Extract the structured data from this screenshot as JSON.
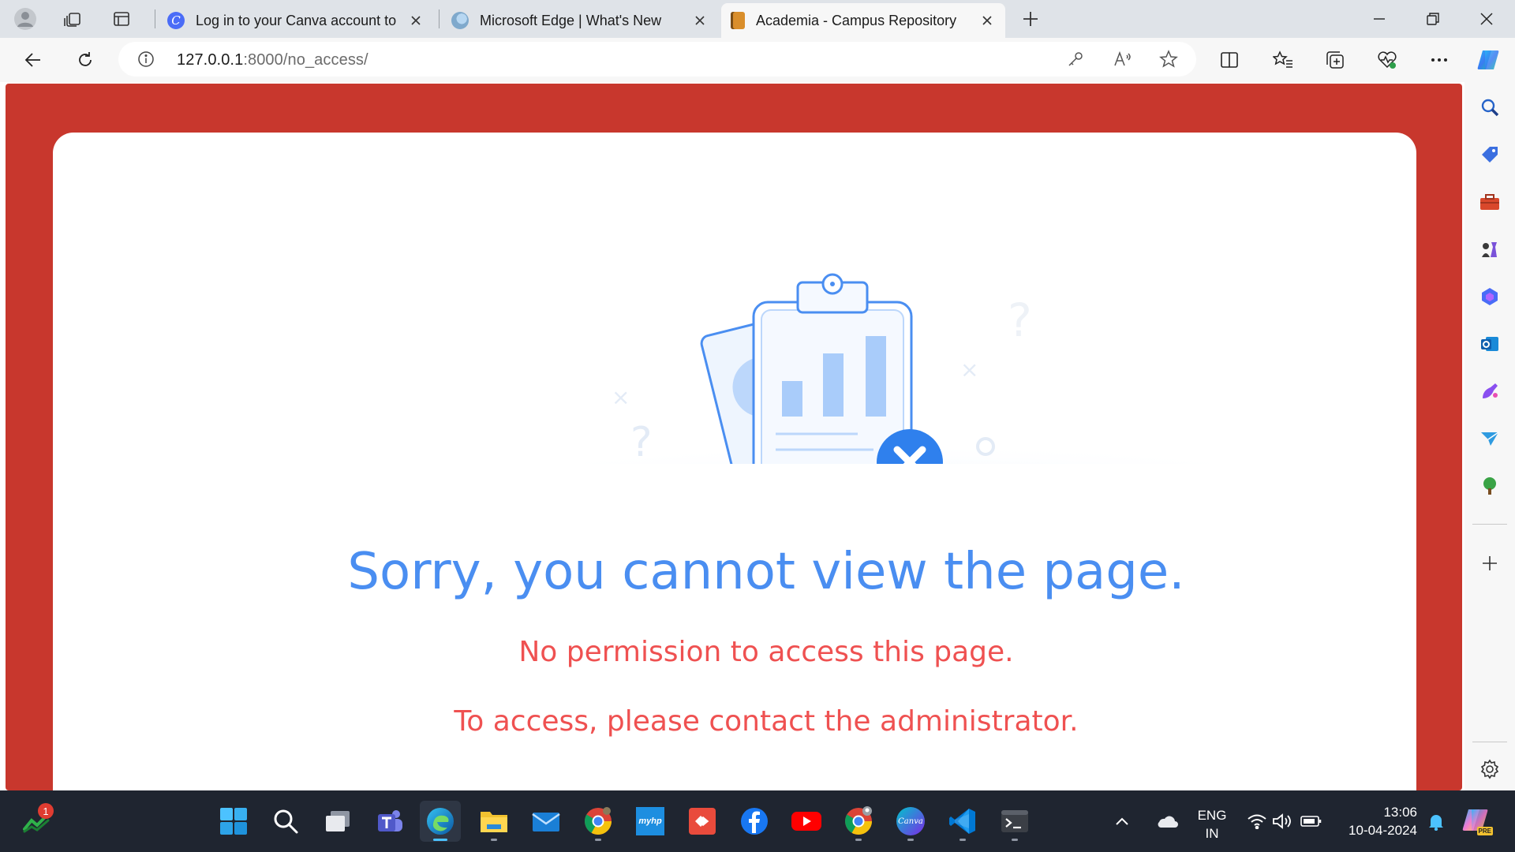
{
  "tabs": [
    {
      "title": "Log in to your Canva account to",
      "favicon": "canva-icon",
      "active": false
    },
    {
      "title": "Microsoft Edge | What's New",
      "favicon": "edge-icon",
      "active": false
    },
    {
      "title": "Academia - Campus Repository",
      "favicon": "notebook-icon",
      "active": true
    }
  ],
  "address_bar": {
    "url_host": "127.0.0.1",
    "url_rest": ":8000/no_access/"
  },
  "page": {
    "title": "Sorry, you cannot view the page.",
    "line1": "No permission to access this page.",
    "line2": "To access, please contact the administrator.",
    "colors": {
      "frame": "#c8372d",
      "title": "#4a8ef1",
      "message": "#ef5151"
    }
  },
  "sidebar": {
    "items": [
      "search-icon",
      "shopping-tag-icon",
      "toolbox-icon",
      "chess-icon",
      "microsoft365-icon",
      "outlook-icon",
      "designer-icon",
      "send-icon",
      "tree-icon",
      "add-icon",
      "settings-icon"
    ]
  },
  "taskbar": {
    "notification_count": "1",
    "apps": [
      "start-icon",
      "search-icon",
      "task-view-icon",
      "teams-icon",
      "edge-icon",
      "file-explorer-icon",
      "mail-icon",
      "chrome-icon",
      "myhp-icon",
      "git-icon",
      "facebook-icon",
      "youtube-icon",
      "chrome-profile-icon",
      "canva-icon",
      "vscode-icon",
      "terminal-icon"
    ],
    "myhp_label": "myhp",
    "canva_label": "Canva",
    "language_top": "ENG",
    "language_bottom": "IN",
    "time": "13:06",
    "date": "10-04-2024",
    "copilot_badge": "PRE"
  }
}
